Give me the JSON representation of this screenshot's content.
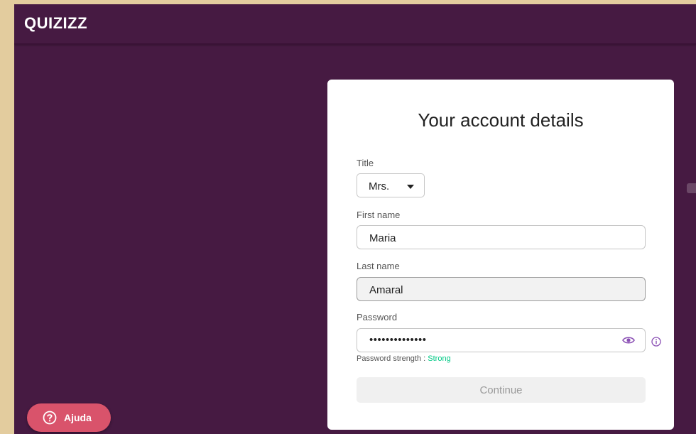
{
  "app": {
    "logo": "QUIZIZZ"
  },
  "form": {
    "title": "Your account details",
    "title_field": {
      "label": "Title",
      "value": "Mrs."
    },
    "first_name": {
      "label": "First name",
      "value": "Maria"
    },
    "last_name": {
      "label": "Last name",
      "value": "Amaral"
    },
    "password": {
      "label": "Password",
      "masked_value": "••••••••••••••",
      "strength_label": "Password strength :",
      "strength_value": "Strong"
    },
    "continue_label": "Continue"
  },
  "help": {
    "label": "Ajuda"
  },
  "colors": {
    "background": "#461a42",
    "strength": "#00c985",
    "help_button": "#d9536b",
    "eye_icon": "#8a4fb4"
  }
}
